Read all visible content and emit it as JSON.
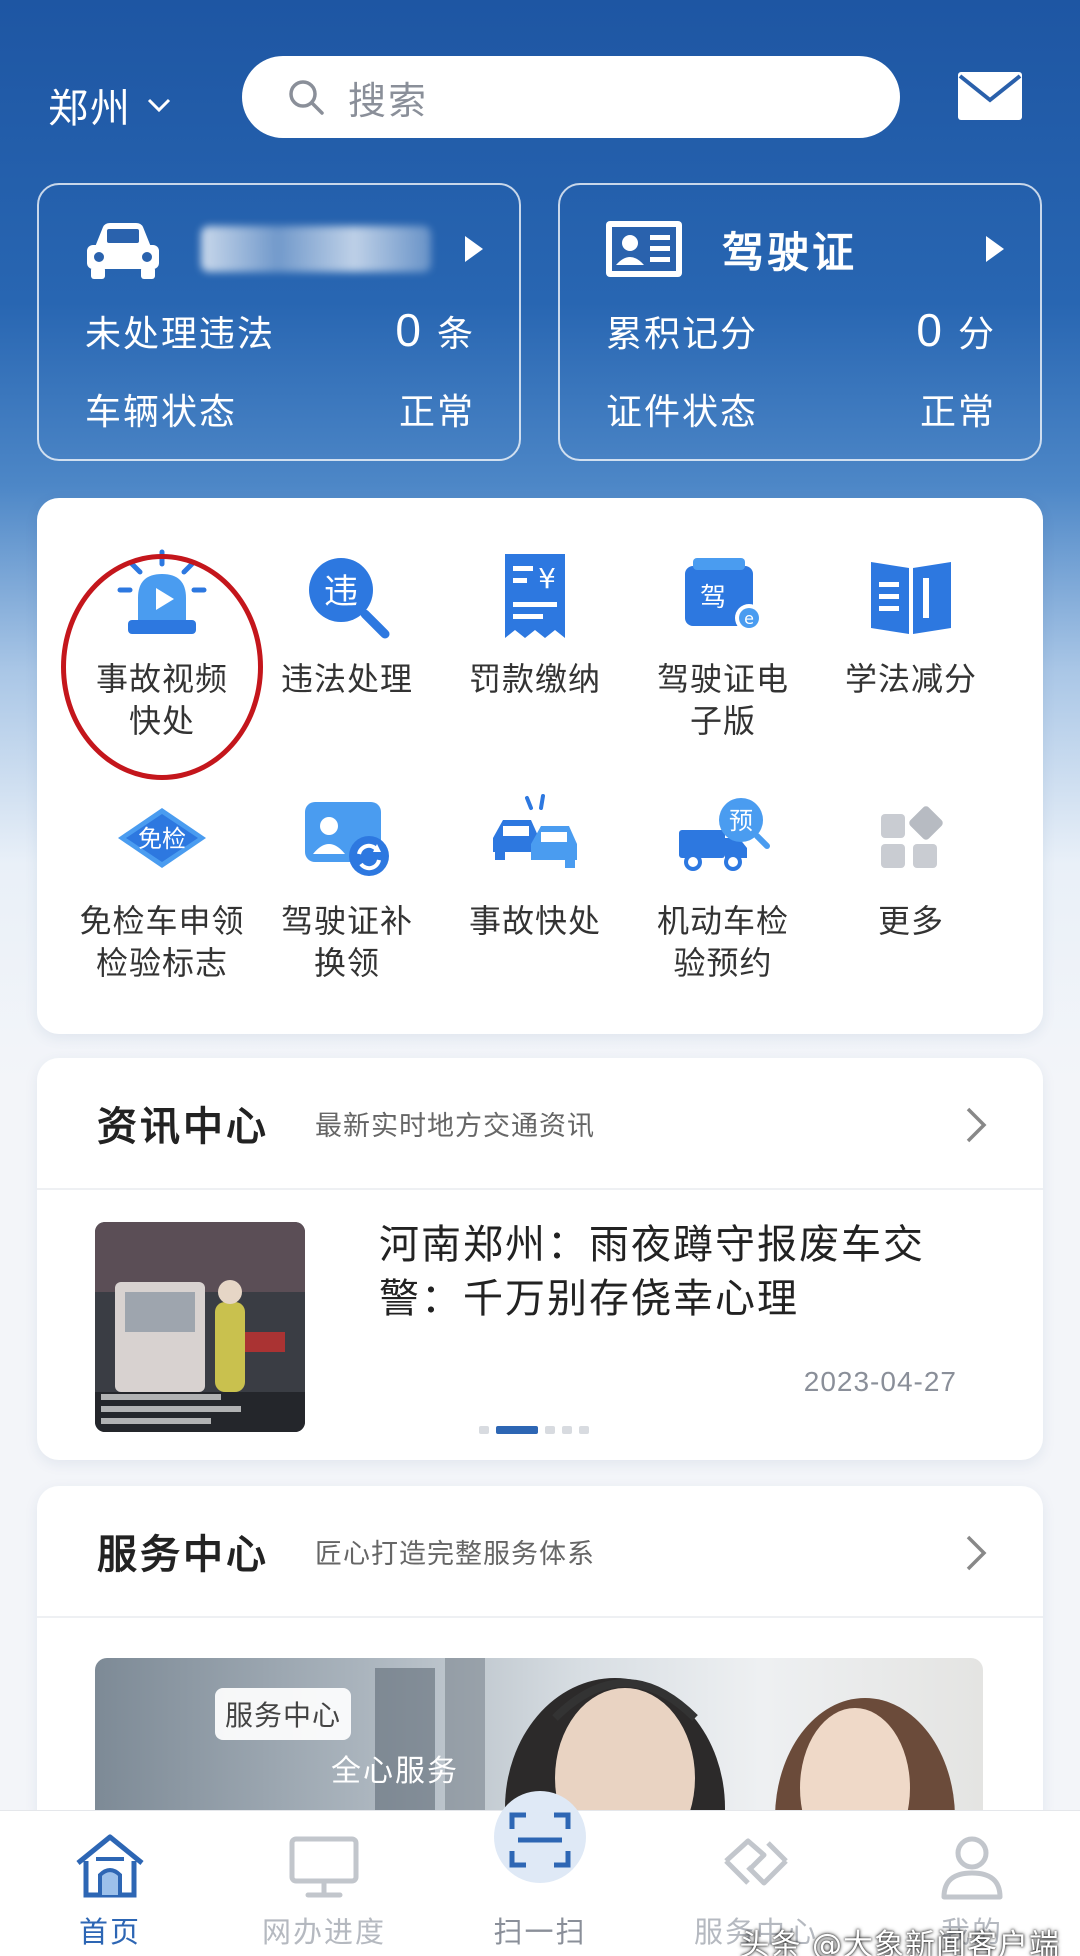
{
  "topbar": {
    "city": "郑州",
    "search_placeholder": "搜索"
  },
  "vehicle_card": {
    "violations_label": "未处理违法",
    "violations_count": "0",
    "violations_unit": "条",
    "status_label": "车辆状态",
    "status_value": "正常"
  },
  "license_card": {
    "title": "驾驶证",
    "points_label": "累积记分",
    "points_value": "0",
    "points_unit": "分",
    "status_label": "证件状态",
    "status_value": "正常"
  },
  "functions": [
    {
      "label": "事故视频快处",
      "icon": "siren-video-icon"
    },
    {
      "label": "违法处理",
      "icon": "violation-search-icon"
    },
    {
      "label": "罚款缴纳",
      "icon": "fine-receipt-icon"
    },
    {
      "label": "驾驶证电子版",
      "icon": "e-license-icon"
    },
    {
      "label": "学法减分",
      "icon": "book-icon"
    },
    {
      "label": "免检车申领检验标志",
      "icon": "exempt-badge-icon"
    },
    {
      "label": "驾驶证补换领",
      "icon": "license-renew-icon"
    },
    {
      "label": "事故快处",
      "icon": "car-crash-icon"
    },
    {
      "label": "机动车检验预约",
      "icon": "truck-booking-icon"
    },
    {
      "label": "更多",
      "icon": "more-grid-icon"
    }
  ],
  "news": {
    "title": "资讯中心",
    "subtitle": "最新实时地方交通资讯",
    "headline": "河南郑州：雨夜蹲守报废车交警：千万别存侥幸心理",
    "date": "2023-04-27"
  },
  "service": {
    "title": "服务中心",
    "subtitle": "匠心打造完整服务体系",
    "banner_tag": "服务中心",
    "banner_text": "全心服务"
  },
  "tabs": [
    {
      "label": "首页",
      "icon": "home-icon"
    },
    {
      "label": "网办进度",
      "icon": "monitor-icon"
    },
    {
      "label": "扫一扫",
      "icon": "scan-icon"
    },
    {
      "label": "服务中心",
      "icon": "handshake-icon"
    },
    {
      "label": "我的",
      "icon": "user-icon"
    }
  ],
  "watermark": "头条 @大象新闻客户端",
  "colors": {
    "brand_blue": "#2d66b4",
    "highlight_red": "#c4161c"
  }
}
